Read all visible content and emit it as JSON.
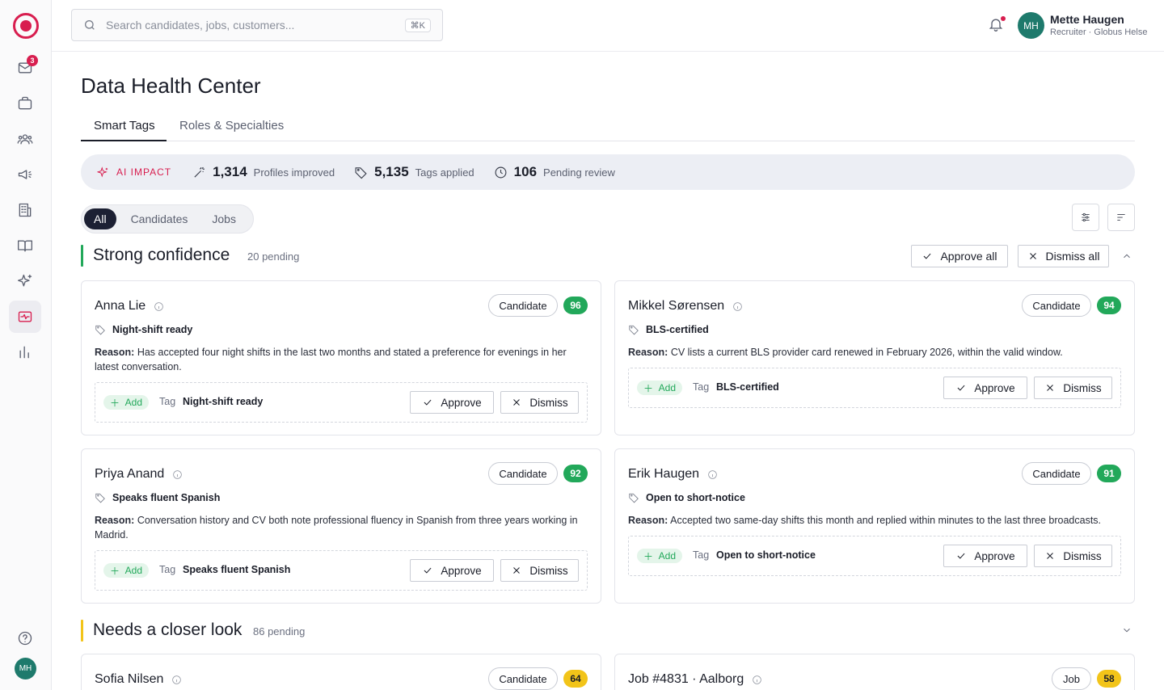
{
  "sidebar": {
    "inbox_badge": "3",
    "avatar_initials": "MH"
  },
  "topbar": {
    "search_placeholder": "Search candidates, jobs, customers...",
    "search_shortcut": "⌘K",
    "user_initials": "MH",
    "user_name": "Mette Haugen",
    "user_role": "Recruiter · Globus Helse"
  },
  "page": {
    "title": "Data Health Center",
    "tabs": [
      "Smart Tags",
      "Roles & Specialties"
    ]
  },
  "impact": {
    "label": "AI IMPACT",
    "stats": [
      {
        "value": "1,314",
        "label": "Profiles improved"
      },
      {
        "value": "5,135",
        "label": "Tags applied"
      },
      {
        "value": "106",
        "label": "Pending review"
      }
    ]
  },
  "filters": [
    "All",
    "Candidates",
    "Jobs"
  ],
  "groups": [
    {
      "title": "Strong confidence",
      "count": "20 pending",
      "approve_all": "Approve all",
      "dismiss_all": "Dismiss all"
    },
    {
      "title": "Needs a closer look",
      "count": "86 pending"
    }
  ],
  "labels": {
    "reason": "Reason:",
    "add": "Add",
    "tag": "Tag",
    "approve": "Approve",
    "dismiss": "Dismiss"
  },
  "cards": [
    {
      "name": "Anna Lie",
      "type": "Candidate",
      "score": "96",
      "tag": "Night-shift ready",
      "reason": "Has accepted four night shifts in the last two months and stated a preference for evenings in her latest conversation."
    },
    {
      "name": "Mikkel Sørensen",
      "type": "Candidate",
      "score": "94",
      "tag": "BLS-certified",
      "reason": "CV lists a current BLS provider card renewed in February 2026, within the valid window."
    },
    {
      "name": "Priya Anand",
      "type": "Candidate",
      "score": "92",
      "tag": "Speaks fluent Spanish",
      "reason": "Conversation history and CV both note professional fluency in Spanish from three years working in Madrid."
    },
    {
      "name": "Erik Haugen",
      "type": "Candidate",
      "score": "91",
      "tag": "Open to short-notice",
      "reason": "Accepted two same-day shifts this month and replied within minutes to the last three broadcasts."
    },
    {
      "name": "Sofia Nilsen",
      "type": "Candidate",
      "score": "64"
    },
    {
      "name": "Job #4831 · Aalborg",
      "type": "Job",
      "score": "58"
    }
  ]
}
